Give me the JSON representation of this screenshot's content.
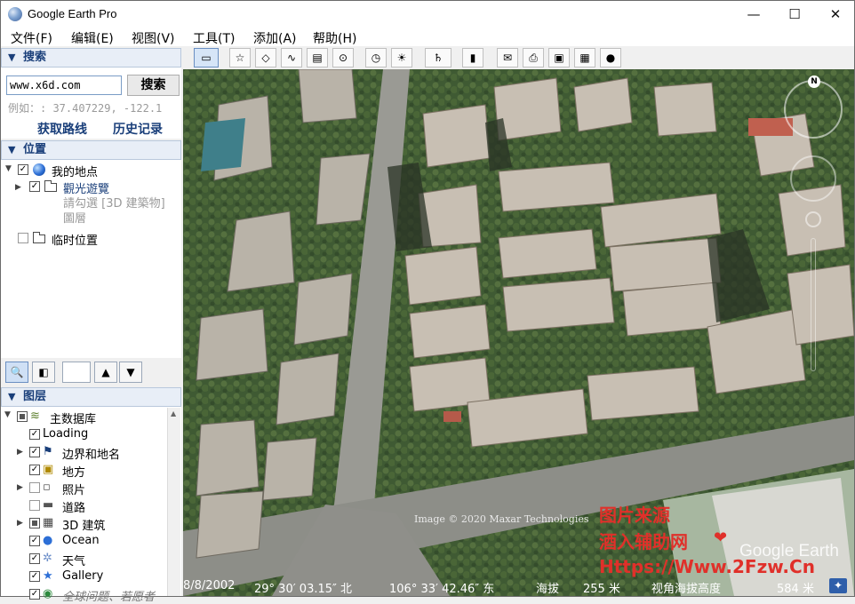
{
  "window": {
    "title": "Google Earth Pro",
    "minimize": "—",
    "maximize": "☐",
    "close": "✕"
  },
  "menu": [
    "文件(F)",
    "编辑(E)",
    "视图(V)",
    "工具(T)",
    "添加(A)",
    "帮助(H)"
  ],
  "search": {
    "header": "搜索",
    "input_value": "www.x6d.com",
    "button": "搜索",
    "hint": "例如：: 37.407229, -122.1",
    "get_directions": "获取路线",
    "history": "历史记录"
  },
  "places": {
    "header": "位置",
    "my_places": "我的地点",
    "tour": "觀光遊覽",
    "tour_hint": "請勾選 [3D 建築物] 圖層",
    "temp": "临时位置"
  },
  "layers": {
    "header": "图层",
    "items": [
      {
        "label": "主数据库",
        "checked": "partial"
      },
      {
        "label": "Loading",
        "checked": "true"
      },
      {
        "label": "边界和地名",
        "checked": "true"
      },
      {
        "label": "地方",
        "checked": "true"
      },
      {
        "label": "照片",
        "checked": "false"
      },
      {
        "label": "道路",
        "checked": "false"
      },
      {
        "label": "3D 建筑",
        "checked": "partial"
      },
      {
        "label": "Ocean",
        "checked": "true"
      },
      {
        "label": "天气",
        "checked": "true"
      },
      {
        "label": "Gallery",
        "checked": "true"
      },
      {
        "label": "全球问题、若愿者",
        "checked": "true"
      }
    ]
  },
  "map": {
    "attribution": "Image © 2020 Maxar Technologies",
    "logo": "Google Earth",
    "status": {
      "date": "8/8/2002",
      "lat": "29° 30′ 03.15″ 北",
      "lon": "106° 33′ 42.46″ 东",
      "elevation_label": "海拔",
      "elevation": "255 米",
      "eye_label": "视角海拔高度",
      "eye": "584 米"
    },
    "compass_n": "N"
  },
  "watermark": {
    "line1": "图片来源",
    "line2": "酒入辅助网",
    "line3": "Https://Www.2Fzw.Cn"
  }
}
